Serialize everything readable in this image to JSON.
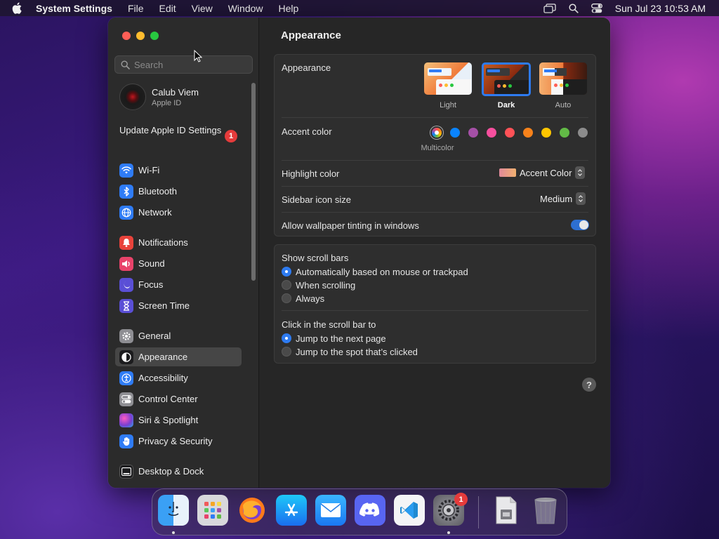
{
  "menubar": {
    "app_name": "System Settings",
    "items": [
      "File",
      "Edit",
      "View",
      "Window",
      "Help"
    ],
    "clock": "Sun Jul 23  10:53 AM"
  },
  "sidebar": {
    "search_placeholder": "Search",
    "profile": {
      "name": "Calub Viem",
      "sub": "Apple ID"
    },
    "update": {
      "label": "Update Apple ID Settings",
      "badge": "1"
    },
    "items": [
      {
        "label": "Wi-Fi",
        "icon": "wifi-icon",
        "color": "#2f7cf6"
      },
      {
        "label": "Bluetooth",
        "icon": "bluetooth-icon",
        "color": "#2f7cf6"
      },
      {
        "label": "Network",
        "icon": "globe-icon",
        "color": "#2f7cf6"
      },
      {
        "label": "Notifications",
        "icon": "bell-icon",
        "color": "#e8433b"
      },
      {
        "label": "Sound",
        "icon": "speaker-icon",
        "color": "#e8436a"
      },
      {
        "label": "Focus",
        "icon": "moon-icon",
        "color": "#5a4fd6"
      },
      {
        "label": "Screen Time",
        "icon": "hourglass-icon",
        "color": "#5a4fd6"
      },
      {
        "label": "General",
        "icon": "gear-icon",
        "color": "#8e8e93"
      },
      {
        "label": "Appearance",
        "icon": "appearance-icon",
        "color": "#1c1c1e"
      },
      {
        "label": "Accessibility",
        "icon": "accessibility-icon",
        "color": "#2f7cf6"
      },
      {
        "label": "Control Center",
        "icon": "control-center-icon",
        "color": "#8e8e93"
      },
      {
        "label": "Siri & Spotlight",
        "icon": "siri-icon",
        "color": "#7a3fd0"
      },
      {
        "label": "Privacy & Security",
        "icon": "hand-icon",
        "color": "#2f7cf6"
      },
      {
        "label": "Desktop & Dock",
        "icon": "dock-icon",
        "color": "#1c1c1e"
      }
    ],
    "selected": "Appearance"
  },
  "main": {
    "title": "Appearance",
    "appearance": {
      "label": "Appearance",
      "options": [
        "Light",
        "Dark",
        "Auto"
      ],
      "selected": "Dark"
    },
    "accent": {
      "label": "Accent color",
      "multicolor_label": "Multicolor",
      "colors": [
        "#ffffff",
        "#0a84ff",
        "#a550a7",
        "#f74f9e",
        "#ff5257",
        "#f7821b",
        "#ffc600",
        "#62ba46",
        "#8c8c8c"
      ],
      "selected_index": 0
    },
    "highlight": {
      "label": "Highlight color",
      "value": "Accent Color"
    },
    "sidebar_icon_size": {
      "label": "Sidebar icon size",
      "value": "Medium"
    },
    "wallpaper_tinting": {
      "label": "Allow wallpaper tinting in windows",
      "on": true
    },
    "scroll_bars": {
      "label": "Show scroll bars",
      "options": [
        "Automatically based on mouse or trackpad",
        "When scrolling",
        "Always"
      ],
      "selected_index": 0
    },
    "click_scroll": {
      "label": "Click in the scroll bar to",
      "options": [
        "Jump to the next page",
        "Jump to the spot that’s clicked"
      ],
      "selected_index": 0
    },
    "help": "?"
  },
  "dock": {
    "apps": [
      "Finder",
      "Launchpad",
      "Firefox",
      "App Store",
      "Mail",
      "Discord",
      "Visual Studio Code",
      "System Settings",
      "Downloads",
      "Trash"
    ],
    "settings_badge": "1"
  }
}
